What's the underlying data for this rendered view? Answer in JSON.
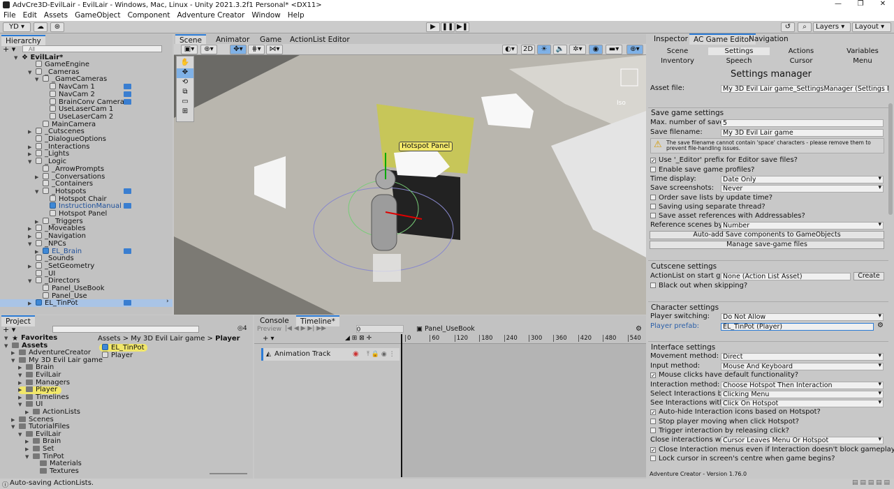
{
  "window": {
    "title": "AdvCre3D-EvilLair - EvilLair - Windows, Mac, Linux - Unity 2021.3.2f1 Personal* <DX11>"
  },
  "menu": [
    "File",
    "Edit",
    "Assets",
    "GameObject",
    "Component",
    "Adventure Creator",
    "Window",
    "Help"
  ],
  "toolbar": {
    "account": "YD",
    "layers": "Layers",
    "layout": "Layout"
  },
  "hierarchy": {
    "tab": "Hierarchy",
    "search_placeholder": "All",
    "scene": "EvilLair*",
    "items": [
      {
        "label": "GameEngine",
        "depth": 1,
        "expanded": null
      },
      {
        "label": "_Cameras",
        "depth": 1,
        "expanded": true
      },
      {
        "label": "_GameCameras",
        "depth": 2,
        "expanded": true
      },
      {
        "label": "NavCam 1",
        "depth": 3,
        "expanded": null
      },
      {
        "label": "NavCam 2",
        "depth": 3,
        "expanded": null
      },
      {
        "label": "BrainConv Camera",
        "depth": 3,
        "expanded": null
      },
      {
        "label": "UseLaserCam 1",
        "depth": 3,
        "expanded": null
      },
      {
        "label": "UseLaserCam 2",
        "depth": 3,
        "expanded": null
      },
      {
        "label": "MainCamera",
        "depth": 2,
        "expanded": null
      },
      {
        "label": "_Cutscenes",
        "depth": 1,
        "expanded": false
      },
      {
        "label": "_DialogueOptions",
        "depth": 1,
        "expanded": null
      },
      {
        "label": "_Interactions",
        "depth": 1,
        "expanded": false
      },
      {
        "label": "_Lights",
        "depth": 1,
        "expanded": false
      },
      {
        "label": "_Logic",
        "depth": 1,
        "expanded": true
      },
      {
        "label": "_ArrowPrompts",
        "depth": 2,
        "expanded": null
      },
      {
        "label": "_Conversations",
        "depth": 2,
        "expanded": false
      },
      {
        "label": "_Containers",
        "depth": 2,
        "expanded": null
      },
      {
        "label": "_Hotspots",
        "depth": 2,
        "expanded": true
      },
      {
        "label": "Hotspot Chair",
        "depth": 3,
        "expanded": null
      },
      {
        "label": "InstructionManual",
        "depth": 3,
        "expanded": null
      },
      {
        "label": "Hotspot Panel",
        "depth": 3,
        "expanded": null
      },
      {
        "label": "_Triggers",
        "depth": 2,
        "expanded": false
      },
      {
        "label": "_Moveables",
        "depth": 1,
        "expanded": false
      },
      {
        "label": "_Navigation",
        "depth": 1,
        "expanded": false
      },
      {
        "label": "_NPCs",
        "depth": 1,
        "expanded": true
      },
      {
        "label": "EL_Brain",
        "depth": 2,
        "expanded": false
      },
      {
        "label": "_Sounds",
        "depth": 1,
        "expanded": null
      },
      {
        "label": "_SetGeometry",
        "depth": 1,
        "expanded": false
      },
      {
        "label": "_UI",
        "depth": 1,
        "expanded": null
      },
      {
        "label": "_Directors",
        "depth": 1,
        "expanded": true
      },
      {
        "label": "Panel_UseBook",
        "depth": 2,
        "expanded": null
      },
      {
        "label": "Panel_Use",
        "depth": 2,
        "expanded": null
      },
      {
        "label": "EL_TinPot",
        "depth": 1,
        "expanded": false
      }
    ]
  },
  "scene_tabs": [
    "Scene",
    "Animator",
    "Game",
    "ActionList Editor"
  ],
  "scene": {
    "mode_2d": "2D",
    "persp": "Iso",
    "hotspot_label": "Hotspot Panel"
  },
  "project": {
    "tabs": [
      "Project"
    ],
    "count": "4",
    "breadcrumb": [
      "Assets",
      "My 3D Evil Lair game",
      "Player"
    ],
    "tree": [
      {
        "label": "Favorites",
        "depth": 0
      },
      {
        "label": "Assets",
        "depth": 0
      },
      {
        "label": "AdventureCreator",
        "depth": 1
      },
      {
        "label": "My 3D Evil Lair game",
        "depth": 1
      },
      {
        "label": "Brain",
        "depth": 2
      },
      {
        "label": "EvilLair",
        "depth": 2
      },
      {
        "label": "Managers",
        "depth": 2
      },
      {
        "label": "Player",
        "depth": 2
      },
      {
        "label": "Timelines",
        "depth": 2
      },
      {
        "label": "UI",
        "depth": 2
      },
      {
        "label": "ActionLists",
        "depth": 3
      },
      {
        "label": "Scenes",
        "depth": 1
      },
      {
        "label": "TutorialFiles",
        "depth": 1
      },
      {
        "label": "EvilLair",
        "depth": 2
      },
      {
        "label": "Brain",
        "depth": 3
      },
      {
        "label": "Set",
        "depth": 3
      },
      {
        "label": "TinPot",
        "depth": 3
      },
      {
        "label": "Materials",
        "depth": 4
      },
      {
        "label": "Textures",
        "depth": 4
      }
    ],
    "files": [
      "EL_TinPot",
      "Player"
    ]
  },
  "timeline": {
    "tabs": [
      "Console",
      "Timeline*"
    ],
    "preview": "Preview",
    "frame": "0",
    "asset": "Panel_UseBook",
    "track": "Animation Track",
    "ticks": [
      "0",
      "60",
      "120",
      "180",
      "240",
      "300",
      "360",
      "420",
      "480",
      "540"
    ]
  },
  "inspector": {
    "tabs": [
      "Inspector",
      "AC Game Editor",
      "Navigation"
    ],
    "subtabs": [
      "Scene",
      "Settings",
      "Actions",
      "Variables",
      "Inventory",
      "Speech",
      "Cursor",
      "Menu"
    ],
    "title": "Settings manager",
    "asset_label": "Asset file:",
    "asset_value": "My 3D Evil Lair game_SettingsManager (Settings Manager)",
    "save": {
      "header": "Save game settings",
      "max_label": "Max. number of saves:",
      "max_value": "5",
      "filename_label": "Save filename:",
      "filename_value": "My 3D Evil Lair game",
      "warning": "The save filename cannot contain 'space' characters - please remove them to prevent file-handling issues.",
      "editor_prefix": "Use '_Editor' prefix for Editor save files?",
      "profiles": "Enable save game profiles?",
      "time_label": "Time display:",
      "time_value": "Date Only",
      "screens_label": "Save screenshots:",
      "screens_value": "Never",
      "order": "Order save lists by update time?",
      "thread": "Saving using separate thread?",
      "addressables": "Save asset references with Addressables?",
      "ref_label": "Reference scenes by:",
      "ref_value": "Number",
      "btn_autoadd": "Auto-add Save components to GameObjects",
      "btn_manage": "Manage save-game files"
    },
    "cutscene": {
      "header": "Cutscene settings",
      "start_label": "ActionList on start game:",
      "start_value": "None (Action List Asset)",
      "create": "Create",
      "blackout": "Black out when skipping?"
    },
    "character": {
      "header": "Character settings",
      "switch_label": "Player switching:",
      "switch_value": "Do Not Allow",
      "prefab_label": "Player prefab:",
      "prefab_value": "EL_TinPot (Player)"
    },
    "interface": {
      "header": "Interface settings",
      "movement_label": "Movement method:",
      "movement_value": "Direct",
      "input_label": "Input method:",
      "input_value": "Mouse And Keyboard",
      "mouse_default": "Mouse clicks have default functionality?",
      "interaction_label": "Interaction method:",
      "interaction_value": "Choose Hotspot Then Interaction",
      "select_label": "Select Interactions by:",
      "select_value": "Clicking Menu",
      "see_label": "See Interactions with:",
      "see_value": "Click On Hotspot",
      "autohide": "Auto-hide Interaction icons based on Hotspot?",
      "stopmove": "Stop player moving when click Hotspot?",
      "trigger": "Trigger interaction by releasing click?",
      "close_label": "Close interactions with:",
      "close_value": "Cursor Leaves Menu Or Hotspot",
      "close_even": "Close Interaction menus even if Interaction doesn't block gameplay?",
      "lock": "Lock cursor in screen's centre when game begins?"
    },
    "footer": "Adventure Creator - Version 1.76.0"
  },
  "status": "Auto-saving ActionLists.",
  "colors": {
    "accent": "#2b7bd6",
    "highlight": "#f1e76a",
    "hotspot": "#c9c94a"
  }
}
